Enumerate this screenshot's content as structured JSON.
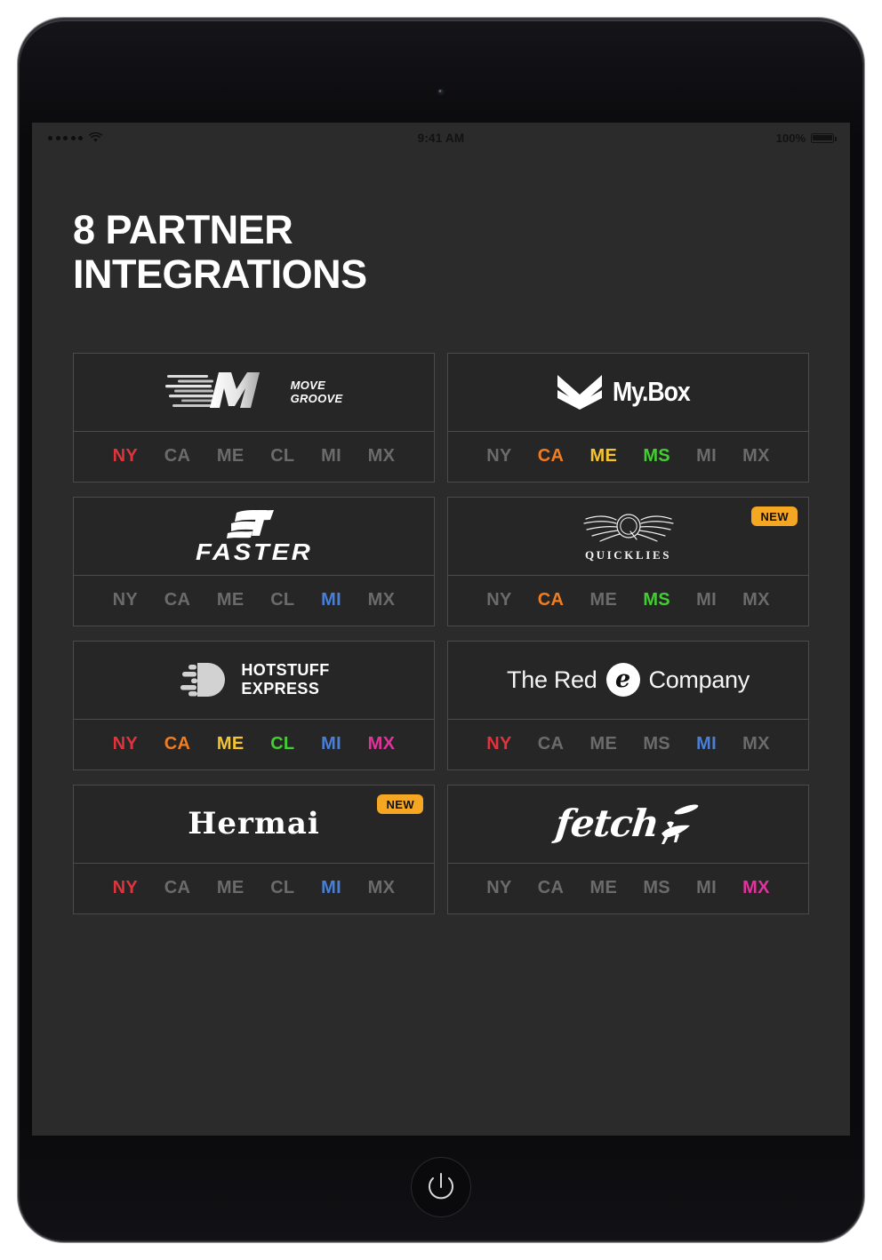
{
  "status_bar": {
    "signal_dots": 5,
    "wifi_icon": "wifi-icon",
    "time": "9:41 AM",
    "battery_percent": "100%",
    "battery_icon": "battery-full-icon"
  },
  "page": {
    "title_line1": "8 PARTNER",
    "title_line2": "INTEGRATIONS",
    "partner_count": 8
  },
  "colors": {
    "background": "#2b2b2b",
    "card_background": "#262626",
    "card_border": "#4b4b4b",
    "region_inactive": "#6b6b6b",
    "badge_new": "#f5a623",
    "NY": "#e0333c",
    "CA": "#f07d22",
    "ME": "#f5c431",
    "CL": "#44cc33",
    "MS": "#44cc33",
    "MI": "#4a7fd4",
    "MX": "#e0339c"
  },
  "badges": {
    "new_label": "NEW"
  },
  "partners": [
    {
      "id": "move-groove",
      "name": "MOVE GROOVE",
      "logo_icon": "move-groove-logo",
      "logo_text_line1": "MOVE",
      "logo_text_line2": "GROOVE",
      "badge": "",
      "regions": [
        {
          "code": "NY",
          "active": true,
          "color": "#e0333c"
        },
        {
          "code": "CA",
          "active": false,
          "color": "#6b6b6b"
        },
        {
          "code": "ME",
          "active": false,
          "color": "#6b6b6b"
        },
        {
          "code": "CL",
          "active": false,
          "color": "#6b6b6b"
        },
        {
          "code": "MI",
          "active": false,
          "color": "#6b6b6b"
        },
        {
          "code": "MX",
          "active": false,
          "color": "#6b6b6b"
        }
      ]
    },
    {
      "id": "my-box",
      "name": "My.Box",
      "logo_icon": "my-box-logo",
      "logo_text_line1": "My.Box",
      "logo_text_line2": "",
      "badge": "",
      "regions": [
        {
          "code": "NY",
          "active": false,
          "color": "#6b6b6b"
        },
        {
          "code": "CA",
          "active": true,
          "color": "#f07d22"
        },
        {
          "code": "ME",
          "active": true,
          "color": "#f5c431"
        },
        {
          "code": "MS",
          "active": true,
          "color": "#44cc33"
        },
        {
          "code": "MI",
          "active": false,
          "color": "#6b6b6b"
        },
        {
          "code": "MX",
          "active": false,
          "color": "#6b6b6b"
        }
      ]
    },
    {
      "id": "faster",
      "name": "FASTER",
      "logo_icon": "faster-logo",
      "logo_text_line1": "FASTER",
      "logo_text_line2": "",
      "badge": "",
      "regions": [
        {
          "code": "NY",
          "active": false,
          "color": "#6b6b6b"
        },
        {
          "code": "CA",
          "active": false,
          "color": "#6b6b6b"
        },
        {
          "code": "ME",
          "active": false,
          "color": "#6b6b6b"
        },
        {
          "code": "CL",
          "active": false,
          "color": "#6b6b6b"
        },
        {
          "code": "MI",
          "active": true,
          "color": "#4a7fd4"
        },
        {
          "code": "MX",
          "active": false,
          "color": "#6b6b6b"
        }
      ]
    },
    {
      "id": "quicklies",
      "name": "QUICKLIES",
      "logo_icon": "quicklies-winged-q-logo",
      "logo_text_line1": "QUICKLIES",
      "logo_text_line2": "",
      "badge": "NEW",
      "regions": [
        {
          "code": "NY",
          "active": false,
          "color": "#6b6b6b"
        },
        {
          "code": "CA",
          "active": true,
          "color": "#f07d22"
        },
        {
          "code": "ME",
          "active": false,
          "color": "#6b6b6b"
        },
        {
          "code": "MS",
          "active": true,
          "color": "#44cc33"
        },
        {
          "code": "MI",
          "active": false,
          "color": "#6b6b6b"
        },
        {
          "code": "MX",
          "active": false,
          "color": "#6b6b6b"
        }
      ]
    },
    {
      "id": "hotstuff-express",
      "name": "HOTSTUFF EXPRESS",
      "logo_icon": "hotstuff-express-logo",
      "logo_text_line1": "HOTSTUFF",
      "logo_text_line2": "EXPRESS",
      "badge": "",
      "regions": [
        {
          "code": "NY",
          "active": true,
          "color": "#e0333c"
        },
        {
          "code": "CA",
          "active": true,
          "color": "#f07d22"
        },
        {
          "code": "ME",
          "active": true,
          "color": "#f5c431"
        },
        {
          "code": "CL",
          "active": true,
          "color": "#44cc33"
        },
        {
          "code": "MI",
          "active": true,
          "color": "#4a7fd4"
        },
        {
          "code": "MX",
          "active": true,
          "color": "#e0339c"
        }
      ]
    },
    {
      "id": "the-red-e-company",
      "name": "The Red e Company",
      "logo_icon": "red-e-logo",
      "logo_text_line1": "The Red",
      "logo_text_line2": "Company",
      "logo_mark_letter": "e",
      "badge": "",
      "regions": [
        {
          "code": "NY",
          "active": true,
          "color": "#e0333c"
        },
        {
          "code": "CA",
          "active": false,
          "color": "#6b6b6b"
        },
        {
          "code": "ME",
          "active": false,
          "color": "#6b6b6b"
        },
        {
          "code": "MS",
          "active": false,
          "color": "#6b6b6b"
        },
        {
          "code": "MI",
          "active": true,
          "color": "#4a7fd4"
        },
        {
          "code": "MX",
          "active": false,
          "color": "#6b6b6b"
        }
      ]
    },
    {
      "id": "hermai",
      "name": "Hermai",
      "logo_icon": "hermai-logo",
      "logo_text_line1": "Hermai",
      "logo_text_line2": "",
      "badge": "NEW",
      "regions": [
        {
          "code": "NY",
          "active": true,
          "color": "#e0333c"
        },
        {
          "code": "CA",
          "active": false,
          "color": "#6b6b6b"
        },
        {
          "code": "ME",
          "active": false,
          "color": "#6b6b6b"
        },
        {
          "code": "CL",
          "active": false,
          "color": "#6b6b6b"
        },
        {
          "code": "MI",
          "active": true,
          "color": "#4a7fd4"
        },
        {
          "code": "MX",
          "active": false,
          "color": "#6b6b6b"
        }
      ]
    },
    {
      "id": "fetch",
      "name": "fetch",
      "logo_icon": "fetch-dog-frisbee-logo",
      "logo_text_line1": "fetch",
      "logo_text_line2": "",
      "badge": "",
      "regions": [
        {
          "code": "NY",
          "active": false,
          "color": "#6b6b6b"
        },
        {
          "code": "CA",
          "active": false,
          "color": "#6b6b6b"
        },
        {
          "code": "ME",
          "active": false,
          "color": "#6b6b6b"
        },
        {
          "code": "MS",
          "active": false,
          "color": "#6b6b6b"
        },
        {
          "code": "MI",
          "active": false,
          "color": "#6b6b6b"
        },
        {
          "code": "MX",
          "active": true,
          "color": "#e0339c"
        }
      ]
    }
  ]
}
